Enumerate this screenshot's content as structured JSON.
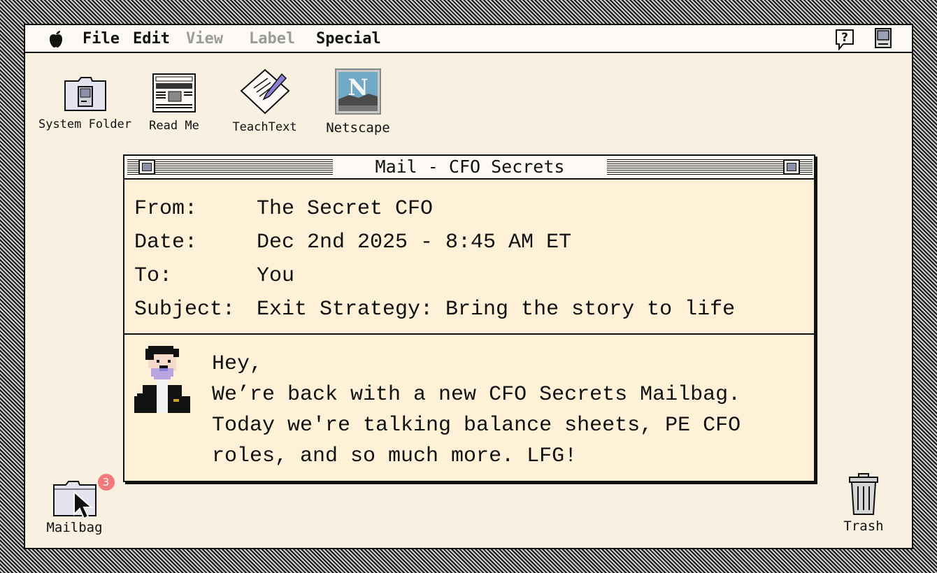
{
  "menubar": {
    "items": [
      {
        "label": "File",
        "enabled": true
      },
      {
        "label": "Edit",
        "enabled": true
      },
      {
        "label": "View",
        "enabled": false
      },
      {
        "label": "Label",
        "enabled": false
      },
      {
        "label": "Special",
        "enabled": true
      }
    ],
    "apple_icon": "apple-icon",
    "help_icon": "help-balloon-icon",
    "finder_icon": "finder-mac-icon"
  },
  "desktop": {
    "icons": [
      {
        "label": "System Folder",
        "icon": "system-folder-icon"
      },
      {
        "label": "Read Me",
        "icon": "newspaper-icon"
      },
      {
        "label": "TeachText",
        "icon": "teachtext-icon"
      },
      {
        "label": "Netscape",
        "icon": "netscape-icon"
      }
    ],
    "mailbag": {
      "label": "Mailbag",
      "icon": "folder-icon",
      "badge": "3"
    },
    "trash": {
      "label": "Trash",
      "icon": "trash-can-icon"
    }
  },
  "mail_window": {
    "title": "Mail - CFO Secrets",
    "headers": {
      "from": {
        "label": "From:",
        "value": "The Secret CFO"
      },
      "date": {
        "label": "Date:",
        "value": "Dec 2nd 2025 - 8:45 AM ET"
      },
      "to": {
        "label": "To:",
        "value": "You"
      },
      "subject": {
        "label": "Subject:",
        "value": "Exit Strategy: Bring the story to life"
      }
    },
    "body": {
      "lines": [
        "Hey,",
        "We’re back with a new CFO Secrets Mailbag.",
        "Today we're talking balance sheets, PE CFO",
        "roles, and so much more. LFG!"
      ]
    }
  },
  "colors": {
    "desktop": "#f8f1e2",
    "window_body": "#fef1d8",
    "badge": "#f27a7a",
    "disabled_menu": "#9b9b9b"
  }
}
